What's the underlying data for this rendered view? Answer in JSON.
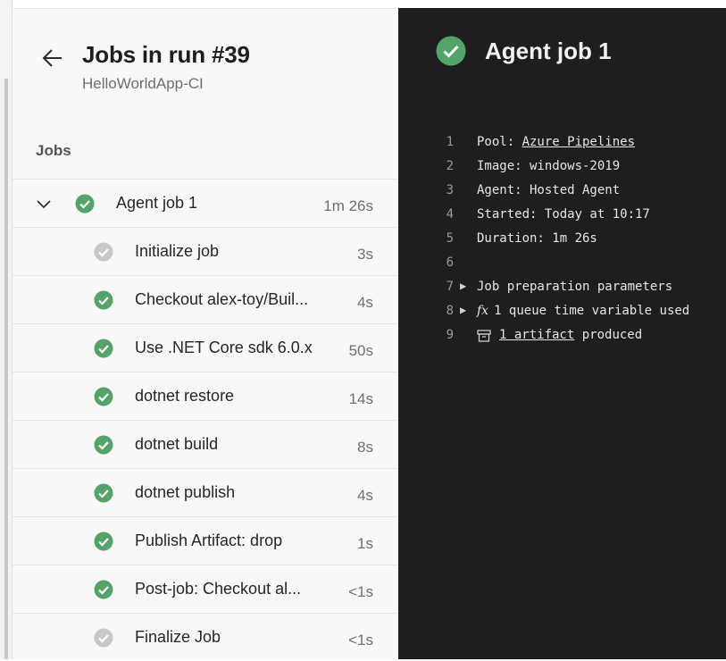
{
  "header": {
    "title": "Jobs in run #39",
    "subtitle": "HelloWorldApp-CI"
  },
  "jobs_section": {
    "label": "Jobs",
    "parent_job": {
      "name": "Agent job 1",
      "duration": "1m 26s",
      "status": "succeeded"
    },
    "steps": [
      {
        "name": "Initialize job",
        "duration": "3s",
        "status": "skipped"
      },
      {
        "name": "Checkout alex-toy/Buil...",
        "duration": "4s",
        "status": "succeeded"
      },
      {
        "name": "Use .NET Core sdk 6.0.x",
        "duration": "50s",
        "status": "succeeded"
      },
      {
        "name": "dotnet restore",
        "duration": "14s",
        "status": "succeeded"
      },
      {
        "name": "dotnet build",
        "duration": "8s",
        "status": "succeeded"
      },
      {
        "name": "dotnet publish",
        "duration": "4s",
        "status": "succeeded"
      },
      {
        "name": "Publish Artifact: drop",
        "duration": "1s",
        "status": "succeeded"
      },
      {
        "name": "Post-job: Checkout al...",
        "duration": "<1s",
        "status": "succeeded"
      },
      {
        "name": "Finalize Job",
        "duration": "<1s",
        "status": "skipped"
      }
    ]
  },
  "detail": {
    "title": "Agent job 1",
    "log": {
      "line1": {
        "num": "1",
        "label": "Pool: ",
        "link": "Azure Pipelines"
      },
      "line2": {
        "num": "2",
        "text": "Image: windows-2019"
      },
      "line3": {
        "num": "3",
        "text": "Agent: Hosted Agent"
      },
      "line4": {
        "num": "4",
        "text": "Started: Today at 10:17"
      },
      "line5": {
        "num": "5",
        "text": "Duration: 1m 26s"
      },
      "line6": {
        "num": "6",
        "text": ""
      },
      "line7": {
        "num": "7",
        "text": "Job preparation parameters"
      },
      "line8": {
        "num": "8",
        "fx": "fx",
        "text": "1 queue time variable used"
      },
      "line9": {
        "num": "9",
        "link": "1 artifact",
        "suffix": " produced"
      }
    }
  },
  "colors": {
    "success": "#53a36a",
    "skipped": "#c8c8c8",
    "dark_bg": "#1e1e1e",
    "light_bg": "#f8f8f8"
  },
  "icons": {
    "back": "arrow-left-icon",
    "expand": "chevron-down-icon",
    "success": "check-circle-icon",
    "skipped": "check-circle-gray-icon",
    "artifact": "artifact-icon"
  }
}
